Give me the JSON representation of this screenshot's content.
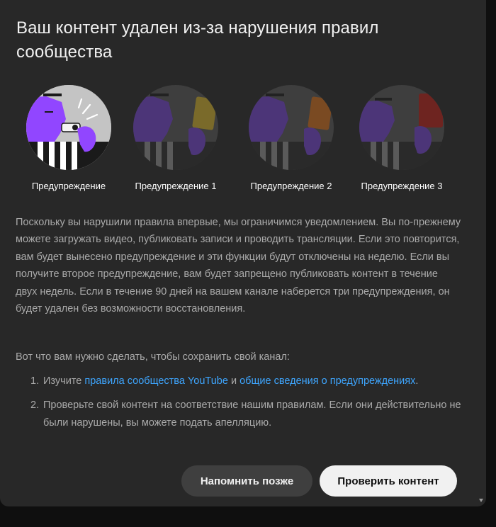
{
  "dialog": {
    "title": "Ваш контент удален из-за нарушения правил сообщества",
    "strikes": [
      {
        "label": "Предупреждение",
        "icon": "whistle-warning-illustration",
        "active": true
      },
      {
        "label": "Предупреждение 1",
        "icon": "yellow-card-illustration",
        "active": false
      },
      {
        "label": "Предупреждение 2",
        "icon": "orange-card-illustration",
        "active": false
      },
      {
        "label": "Предупреждение 3",
        "icon": "red-card-illustration",
        "active": false
      }
    ],
    "body": "Поскольку вы нарушили правила впервые, мы ограничимся уведомлением. Вы по-прежнему можете загружать видео, публиковать записи и проводить трансляции. Если это повторится, вам будет вынесено предупреждение и эти функции будут отключены на неделю. Если вы получите второе предупреждение, вам будет запрещено публиковать контент в течение двух недель. Если в течение 90 дней на вашем канале наберется три предупреждения, он будет удален без возможности восстановления.",
    "intro": "Вот что вам нужно сделать, чтобы сохранить свой канал:",
    "steps": [
      {
        "number": "1.",
        "prefix": "Изучите ",
        "link1": "правила сообщества YouTube",
        "middle": " и ",
        "link2": "общие сведения о предупреждениях",
        "suffix": "."
      },
      {
        "number": "2.",
        "text": "Проверьте свой контент на соответствие нашим правилам. Если они действительно не были нарушены, вы можете подать апелляцию."
      }
    ],
    "buttons": {
      "later": "Напомнить позже",
      "check": "Проверить контент"
    }
  },
  "colors": {
    "background": "#282828",
    "link": "#3ea6ff",
    "purple": "#9146ff",
    "yellow_card": "#c9a227",
    "orange_card": "#d8742a",
    "red_card": "#d8261c"
  }
}
